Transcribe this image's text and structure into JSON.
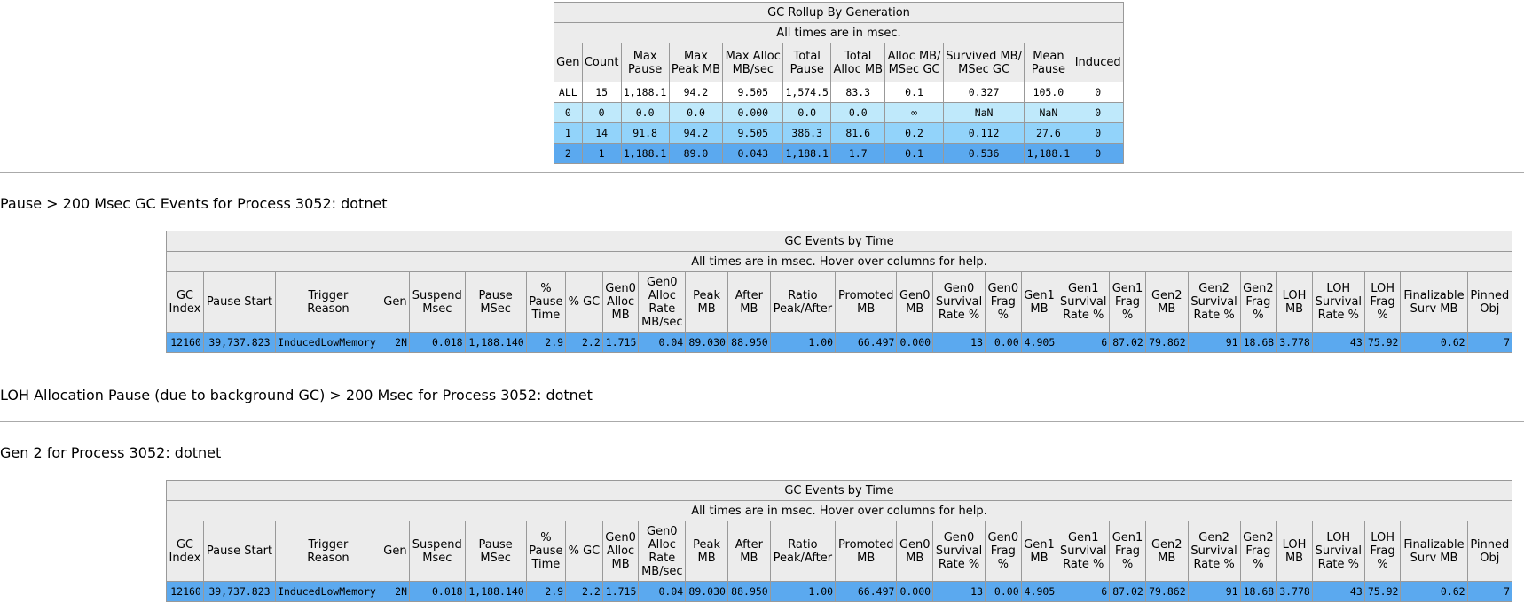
{
  "rollup": {
    "title": "GC Rollup By Generation",
    "subtitle": "All times are in msec.",
    "headers": [
      [
        "Gen"
      ],
      [
        "Count"
      ],
      [
        "Max",
        "Pause"
      ],
      [
        "Max",
        "Peak MB"
      ],
      [
        "Max Alloc",
        "MB/sec"
      ],
      [
        "Total",
        "Pause"
      ],
      [
        "Total",
        "Alloc MB"
      ],
      [
        "Alloc MB/",
        "MSec GC"
      ],
      [
        "Survived MB/",
        "MSec GC"
      ],
      [
        "Mean",
        "Pause"
      ],
      [
        "Induced"
      ]
    ],
    "rows": [
      [
        "ALL",
        "15",
        "1,188.1",
        "94.2",
        "9.505",
        "1,574.5",
        "83.3",
        "0.1",
        "0.327",
        "105.0",
        "0"
      ],
      [
        "0",
        "0",
        "0.0",
        "0.0",
        "0.000",
        "0.0",
        "0.0",
        "∞",
        "NaN",
        "NaN",
        "0"
      ],
      [
        "1",
        "14",
        "91.8",
        "94.2",
        "9.505",
        "386.3",
        "81.6",
        "0.2",
        "0.112",
        "27.6",
        "0"
      ],
      [
        "2",
        "1",
        "1,188.1",
        "89.0",
        "0.043",
        "1,188.1",
        "1.7",
        "0.1",
        "0.536",
        "1,188.1",
        "0"
      ]
    ],
    "row_colors": [
      "#ffffff",
      "#bfe9fb",
      "#92d3fa",
      "#5ba9ef"
    ]
  },
  "section1": {
    "heading": "Pause > 200 Msec GC Events for Process 3052: dotnet"
  },
  "section2": {
    "heading": "LOH Allocation Pause (due to background GC) > 200 Msec for Process 3052: dotnet"
  },
  "section3": {
    "heading": "Gen 2 for Process 3052: dotnet"
  },
  "events": {
    "title": "GC Events by Time",
    "subtitle": "All times are in msec. Hover over columns for help.",
    "headers": [
      [
        "GC",
        "Index"
      ],
      [
        "Pause Start"
      ],
      [
        "Trigger",
        "Reason"
      ],
      [
        "Gen"
      ],
      [
        "Suspend",
        "Msec"
      ],
      [
        "Pause",
        "MSec"
      ],
      [
        "%",
        "Pause",
        "Time"
      ],
      [
        "% GC"
      ],
      [
        "Gen0",
        "Alloc",
        "MB"
      ],
      [
        "Gen0",
        "Alloc",
        "Rate",
        "MB/sec"
      ],
      [
        "Peak",
        "MB"
      ],
      [
        "After",
        "MB"
      ],
      [
        "Ratio",
        "Peak/After"
      ],
      [
        "Promoted",
        "MB"
      ],
      [
        "Gen0",
        "MB"
      ],
      [
        "Gen0",
        "Survival",
        "Rate %"
      ],
      [
        "Gen0",
        "Frag",
        "%"
      ],
      [
        "Gen1",
        "MB"
      ],
      [
        "Gen1",
        "Survival",
        "Rate %"
      ],
      [
        "Gen1",
        "Frag",
        "%"
      ],
      [
        "Gen2",
        "MB"
      ],
      [
        "Gen2",
        "Survival",
        "Rate %"
      ],
      [
        "Gen2",
        "Frag",
        "%"
      ],
      [
        "LOH",
        "MB"
      ],
      [
        "LOH",
        "Survival",
        "Rate %"
      ],
      [
        "LOH",
        "Frag",
        "%"
      ],
      [
        "Finalizable",
        "Surv MB"
      ],
      [
        "Pinned",
        "Obj"
      ]
    ],
    "row": [
      "12160",
      "39,737.823",
      "InducedLowMemory",
      "2N",
      "0.018",
      "1,188.140",
      "2.9",
      "2.2",
      "1.715",
      "0.04",
      "89.030",
      "88.950",
      "1.00",
      "66.497",
      "0.000",
      "13",
      "0.00",
      "4.905",
      "6",
      "87.02",
      "79.862",
      "91",
      "18.68",
      "3.778",
      "43",
      "75.92",
      "0.62",
      "7"
    ],
    "row_color": "#5ba9ef"
  }
}
